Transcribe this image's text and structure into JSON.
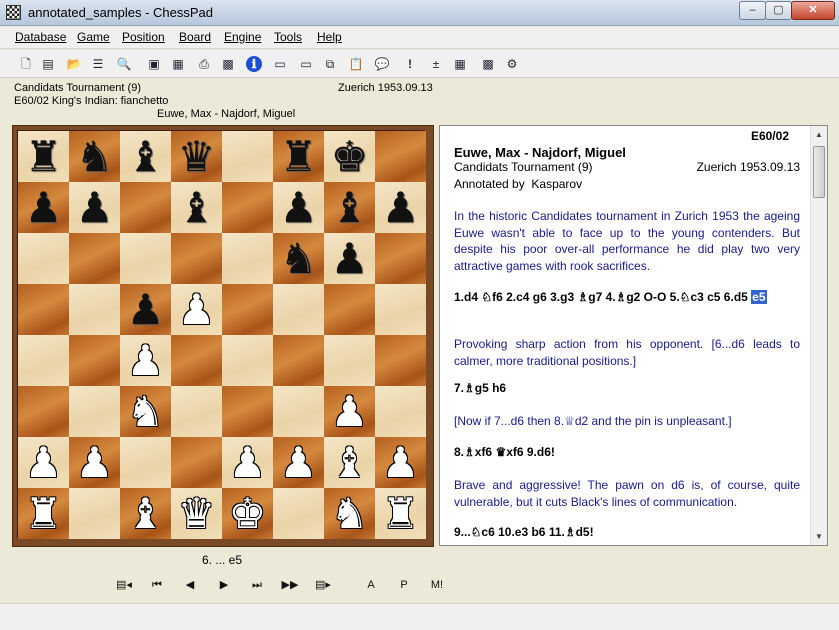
{
  "window": {
    "title": "annotated_samples - ChessPad",
    "min": "–",
    "max": "▢",
    "close": "✕"
  },
  "menu": [
    "Database",
    "Game",
    "Position",
    "Board",
    "Engine",
    "Tools",
    "Help"
  ],
  "toolbar": [
    {
      "name": "new-file-icon",
      "glyph": "🗋"
    },
    {
      "name": "new-game-icon",
      "glyph": "▤"
    },
    {
      "name": "open-folder-icon",
      "glyph": "📂"
    },
    {
      "name": "game-list-icon",
      "glyph": "☰"
    },
    {
      "name": "find-binoculars-icon",
      "glyph": "🔍"
    },
    {
      "name": "copy-game-icon",
      "glyph": "▣"
    },
    {
      "name": "board-setup-icon",
      "glyph": "▦"
    },
    {
      "name": "print-icon",
      "glyph": "⎙"
    },
    {
      "name": "print-board-icon",
      "glyph": "▩"
    },
    {
      "name": "info-icon",
      "glyph": "ℹ"
    },
    {
      "name": "save-icon",
      "glyph": "▭"
    },
    {
      "name": "save-as-icon",
      "glyph": "▭"
    },
    {
      "name": "copy-icon",
      "glyph": "⧉"
    },
    {
      "name": "paste-icon",
      "glyph": "📋"
    },
    {
      "name": "comment-icon",
      "glyph": "💬"
    },
    {
      "name": "exclamation-icon",
      "glyph": "!"
    },
    {
      "name": "plus-minus-icon",
      "glyph": "±"
    },
    {
      "name": "flip-board-icon",
      "glyph": "▦"
    },
    {
      "name": "board-style-icon",
      "glyph": "▩"
    },
    {
      "name": "engine-icon",
      "glyph": "⚙"
    }
  ],
  "game_header": {
    "event": "Candidats Tournament (9)",
    "site_date": "Zuerich 1953.09.13",
    "opening": "E60/02 King's Indian: fianchetto",
    "players": "Euwe, Max - Najdorf, Miguel"
  },
  "board": {
    "rows": [
      [
        "r",
        "n",
        "b",
        "q",
        "",
        "r",
        "k",
        ""
      ],
      [
        "p",
        "p",
        "",
        "b",
        "",
        "p",
        "b",
        "p"
      ],
      [
        "",
        "",
        "",
        "",
        "",
        "n",
        "p",
        ""
      ],
      [
        "",
        "",
        "p",
        "P",
        "",
        "",
        "",
        ""
      ],
      [
        "",
        "",
        "P",
        "",
        "",
        "",
        "",
        ""
      ],
      [
        "",
        "",
        "N",
        "",
        "",
        "",
        "P",
        ""
      ],
      [
        "P",
        "P",
        "",
        "",
        "P",
        "P",
        "B",
        "P"
      ],
      [
        "R",
        "",
        "B",
        "Q",
        "K",
        "",
        "N",
        "R"
      ]
    ]
  },
  "current_move": "6. ... e5",
  "nav": [
    {
      "name": "variation-back-icon",
      "glyph": "▤◂"
    },
    {
      "name": "first-move-icon",
      "glyph": "⏮"
    },
    {
      "name": "previous-move-icon",
      "glyph": "◀"
    },
    {
      "name": "next-move-icon",
      "glyph": "▶"
    },
    {
      "name": "last-move-icon",
      "glyph": "⏭"
    },
    {
      "name": "autoplay-icon",
      "glyph": "▶▶"
    },
    {
      "name": "variation-forward-icon",
      "glyph": "▤▸"
    },
    {
      "name": "annotate-a-button",
      "glyph": "A"
    },
    {
      "name": "annotate-p-button",
      "glyph": "P"
    },
    {
      "name": "annotate-m-button",
      "glyph": "M!"
    }
  ],
  "notation": {
    "eco": "E60/02",
    "players": "Euwe, Max - Najdorf, Miguel",
    "event": "Candidats Tournament (9)",
    "site_date": "Zuerich 1953.09.13",
    "annotator_label": "Annotated by",
    "annotator": "Kasparov",
    "paragraphs": [
      {
        "kind": "comment",
        "text": "In the historic Candidates tournament in Zurich 1953 the ageing Euwe wasn't able to face up to the young contenders. But despite his poor over-all performance he did play two very attractive games with rook sacrifices."
      },
      {
        "kind": "moves",
        "text": "1.d4 ♘f6 2.c4 g6 3.g3 ♗g7 4.♗g2 O-O 5.♘c3 c5 6.d5",
        "highlight": "e5"
      },
      {
        "kind": "comment",
        "text": "Provoking sharp action from his opponent. [6...d6 leads to calmer, more traditional positions.]"
      },
      {
        "kind": "moves",
        "text": "7.♗g5 h6"
      },
      {
        "kind": "comment",
        "text": "[Now if 7...d6 then 8.♕d2 and the pin is unpleasant.]"
      },
      {
        "kind": "moves",
        "text": "8.♗xf6 ♛xf6 9.d6!"
      },
      {
        "kind": "comment",
        "text": "Brave and aggressive! The pawn on d6 is, of course, quite vulnerable, but it cuts Black's lines of communication."
      },
      {
        "kind": "moves",
        "text": "9...♘c6 10.e3 b6 11.♗d5!"
      }
    ]
  },
  "scroll": {
    "up": "▲",
    "down": "▼"
  },
  "colors": {
    "light_square": "#f0dfbf",
    "dark_square": "#c57a34",
    "comment_text": "#1a1a8c",
    "highlight": "#3366cc"
  }
}
